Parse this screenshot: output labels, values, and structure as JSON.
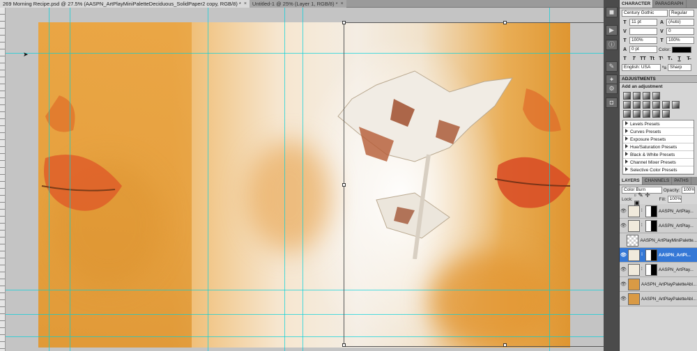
{
  "document_tabs": [
    {
      "title": "269 Morning Recipe.psd @ 27.5% (AASPN_ArtPlayMiniPaletteDeciduous_SolidPaper2 copy, RGB/8) *",
      "close": "×",
      "active": true
    },
    {
      "title": "Untitled-1 @ 25% (Layer 1, RGB/8) *",
      "close": "×",
      "active": false
    }
  ],
  "tool_strip": {
    "icons": [
      "swatch-icon",
      "play-icon",
      "info-icon",
      "brush-icon",
      "clone-icon",
      "gear-icon",
      "mask-icon"
    ],
    "glyphs": [
      "◼",
      "▶",
      "ⓘ",
      "✎",
      "✦",
      "⚙",
      "◘"
    ]
  },
  "character": {
    "tabs": [
      "CHARACTER",
      "PARAGRAPH"
    ],
    "font_family": "Century Gothic",
    "font_style": "Regular",
    "font_size": "11 pt",
    "leading": "(Auto)",
    "kerning": "",
    "tracking": "0",
    "vertical_scale": "100%",
    "horizontal_scale": "100%",
    "baseline_shift": "0 pt",
    "color_label": "Color:",
    "color_value": "#000000",
    "style_buttons": [
      "T",
      "T",
      "TT",
      "Tt",
      "T¹",
      "T₁",
      "T",
      "T̶"
    ],
    "language": "English: USA",
    "antialias_label": "ªa",
    "antialias": "Sharp"
  },
  "adjustments": {
    "title": "ADJUSTMENTS",
    "subtitle": "Add an adjustment",
    "presets": [
      "Levels Presets",
      "Curves Presets",
      "Exposure Presets",
      "Hue/Saturation Presets",
      "Black & White Presets",
      "Channel Mixer Presets",
      "Selective Color Presets"
    ]
  },
  "layers": {
    "tabs": [
      "LAYERS",
      "CHANNELS",
      "PATHS"
    ],
    "blend_mode": "Color Burn",
    "opacity_label": "Opacity:",
    "opacity": "100%",
    "lock_label": "Lock:",
    "fill_label": "Fill:",
    "fill": "100%",
    "items": [
      {
        "name": "AASPN_ArtPlay...",
        "visible": true,
        "mask": true,
        "thumb": "plain",
        "selected": false
      },
      {
        "name": "AASPN_ArtPlay...",
        "visible": true,
        "mask": true,
        "thumb": "plain",
        "selected": false
      },
      {
        "name": "AASPN_ArtPlayMiniPalette...",
        "visible": false,
        "mask": false,
        "thumb": "checker",
        "selected": false
      },
      {
        "name": "AASPN_ArtPl...",
        "visible": true,
        "mask": true,
        "thumb": "plain",
        "selected": true
      },
      {
        "name": "AASPN_ArtPlay...",
        "visible": true,
        "mask": true,
        "thumb": "plain",
        "selected": false
      },
      {
        "name": "AASPN_ArtPlayPaletteAbl...",
        "visible": true,
        "mask": false,
        "thumb": "orange",
        "selected": false
      },
      {
        "name": "AASPN_ArtPlayPaletteAbl...",
        "visible": true,
        "mask": false,
        "thumb": "orange",
        "selected": false
      }
    ]
  },
  "colors": {
    "selection": "#3578d6",
    "guide": "#00d2dc",
    "paper_orange": "#e6a03e"
  }
}
